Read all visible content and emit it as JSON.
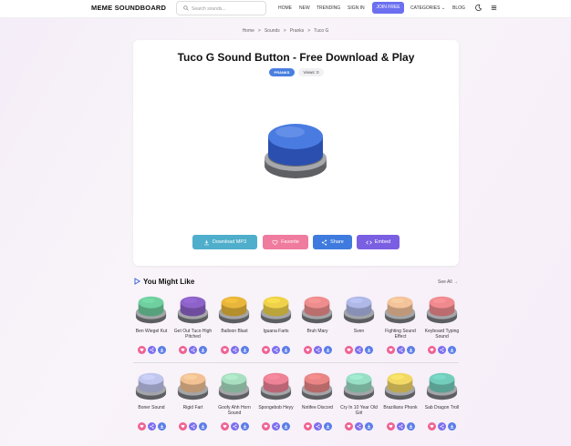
{
  "header": {
    "logo": "MEME SOUNDBOARD",
    "search_placeholder": "Search sounds...",
    "nav": [
      "HOME",
      "NEW",
      "TRENDING",
      "SIGN IN"
    ],
    "join": "JOIN FREE",
    "categories": "CATEGORIES",
    "blog": "BLOG"
  },
  "breadcrumb": [
    "Home",
    ">",
    "Sounds",
    ">",
    "Pranks",
    ">",
    "Tuco G"
  ],
  "main": {
    "title": "Tuco G Sound Button - Free Download & Play",
    "badge": "PRANKS",
    "views": "Views: 0",
    "actions": {
      "download": "Download MP3",
      "favorite": "Favorite",
      "share": "Share",
      "embed": "Embed"
    },
    "button_color": "#4a7be0"
  },
  "related": {
    "title": "You Might Like",
    "see_all": "See All →",
    "row1": [
      {
        "label": "Ben Wiegel Kut",
        "color": "#6fcf9f"
      },
      {
        "label": "Get Out Tuco High Pitched",
        "color": "#8e63c9"
      },
      {
        "label": "Balloon Blast",
        "color": "#e8b63a"
      },
      {
        "label": "Iguana Farts",
        "color": "#f0d24a"
      },
      {
        "label": "Bruh Mary",
        "color": "#ee8d8d"
      },
      {
        "label": "Sven",
        "color": "#b0b8e8"
      },
      {
        "label": "Fighting Sound Effect",
        "color": "#f3c39a"
      },
      {
        "label": "Keyboard Typing Sound",
        "color": "#f08a8e"
      }
    ],
    "row2": [
      {
        "label": "Boner Sound",
        "color": "#c0c6ee"
      },
      {
        "label": "Rigid Fart",
        "color": "#f2c295"
      },
      {
        "label": "Goofy Ahh Horn Sound",
        "color": "#a8dfc1"
      },
      {
        "label": "Spongebob Heyy",
        "color": "#ee8296"
      },
      {
        "label": "Notifee Discord",
        "color": "#ea8585"
      },
      {
        "label": "Cry In 10 Year Old Girl",
        "color": "#98dfc6"
      },
      {
        "label": "Brazilians Phonk",
        "color": "#f2d865"
      },
      {
        "label": "Sab Dragon Troll",
        "color": "#73cdbc"
      }
    ]
  }
}
